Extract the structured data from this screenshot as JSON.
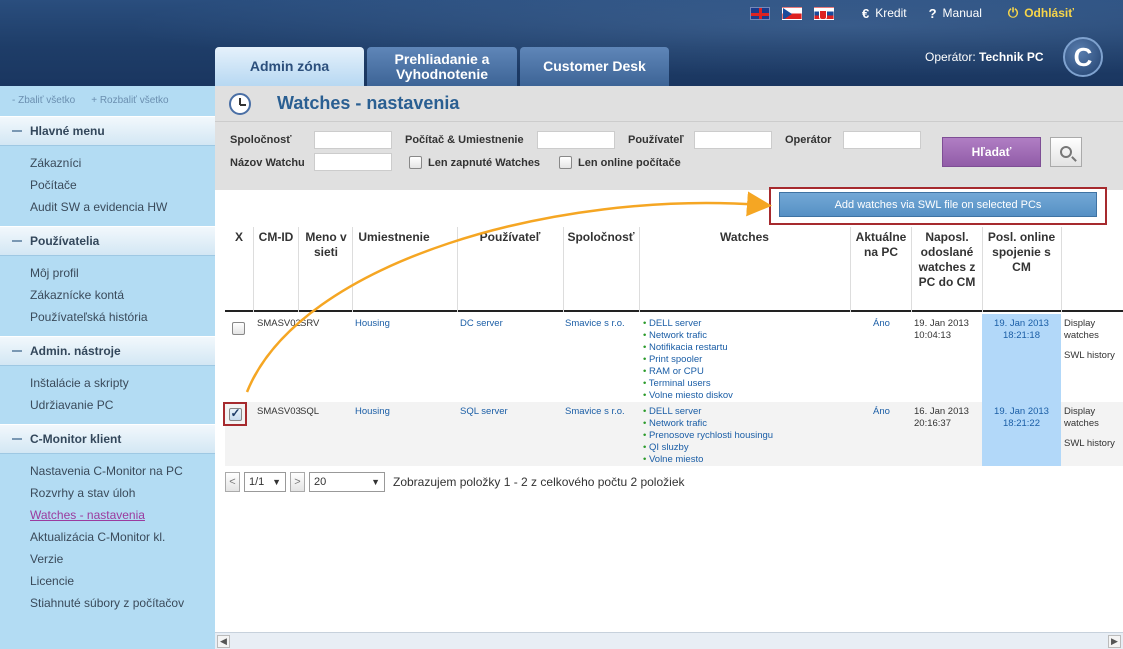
{
  "header": {
    "links": {
      "credit": "Kredit",
      "manual": "Manual",
      "logout": "Odhlásiť"
    },
    "tabs": [
      {
        "label": "Admin zóna"
      },
      {
        "label": "Prehliadanie a Vyhodnotenie"
      },
      {
        "label": "Customer Desk"
      }
    ],
    "operator_label": "Operátor:",
    "operator_name": "Technik PC"
  },
  "sidebar": {
    "collapse_all": "- Zbaliť všetko",
    "expand_all": "+ Rozbaliť všetko",
    "sections": [
      {
        "title": "Hlavné menu",
        "items": [
          "Zákazníci",
          "Počítače",
          "Audit SW a evidencia HW"
        ]
      },
      {
        "title": "Používatelia",
        "items": [
          "Môj profil",
          "Zákaznícke kontá",
          "Používateľská história"
        ]
      },
      {
        "title": "Admin. nástroje",
        "items": [
          "Inštalácie a skripty",
          "Udržiavanie PC"
        ]
      },
      {
        "title": "C-Monitor klient",
        "items": [
          "Nastavenia C-Monitor na PC",
          "Rozvrhy a stav úloh",
          "Watches - nastavenia",
          "Aktualizácia C-Monitor kl.",
          "Verzie",
          "Licencie",
          "Stiahnuté súbory z počítačov"
        ]
      }
    ]
  },
  "page": {
    "title": "Watches - nastavenia"
  },
  "filter": {
    "company_label": "Spoločnosť",
    "computer_label": "Počítač & Umiestnenie",
    "user_label": "Používateľ",
    "operator_label": "Operátor",
    "watch_name_label": "Názov Watchu",
    "only_enabled_label": "Len zapnuté Watches",
    "only_online_label": "Len online počítače",
    "search_label": "Hľadať"
  },
  "add_button_label": "Add watches via SWL file on selected PCs",
  "table": {
    "headers": {
      "x": "X",
      "cmid": "CM-ID",
      "network_name": "Meno v sieti",
      "location": "Umiestnenie",
      "user": "Používateľ",
      "company": "Spoločnosť",
      "watches": "Watches",
      "current_on_pc": "Aktuálne na PC",
      "last_sent": "Naposl. odoslané watches z PC do CM",
      "last_online": "Posl. online spojenie s CM"
    },
    "rows": [
      {
        "cmid": "SMASV02",
        "network_name": "SRV",
        "location": "Housing",
        "user": "DC server",
        "company": "Smavice s r.o.",
        "watches": [
          "DELL server",
          "Network trafic",
          "Notifikacia restartu",
          "Print spooler",
          "RAM or CPU",
          "Terminal users",
          "Volne miesto diskov"
        ],
        "current": "Áno",
        "last_sent_date": "19. Jan 2013",
        "last_sent_time": "10:04:13",
        "last_online_date": "19. Jan 2013",
        "last_online_time": "18:21:18",
        "action_display": "Display watches",
        "action_history": "SWL history"
      },
      {
        "cmid": "SMASV03",
        "network_name": "SQL",
        "location": "Housing",
        "user": "SQL server",
        "company": "Smavice s r.o.",
        "watches": [
          "DELL server",
          "Network trafic",
          "Prenosove rychlosti housingu",
          "QI sluzby",
          "Volne miesto"
        ],
        "current": "Áno",
        "last_sent_date": "16. Jan 2013",
        "last_sent_time": "20:16:37",
        "last_online_date": "19. Jan 2013",
        "last_online_time": "18:21:22",
        "action_display": "Display watches",
        "action_history": "SWL history"
      }
    ]
  },
  "pager": {
    "prev": "<",
    "page": "1/1",
    "next": ">",
    "per_page": "20",
    "summary": "Zobrazujem položky 1 - 2 z celkového počtu 2 položiek"
  },
  "colors": {
    "header_bg": "#1e3d68",
    "sidebar_bg": "#b3dcf3",
    "search_button": "#a26bb8",
    "add_button": "#5b95c9",
    "highlight_cell": "#b2d8f9",
    "annotation_red": "#a62a2e",
    "annotation_arrow": "#f5a623"
  },
  "icons": {
    "credit": "euro-icon",
    "manual": "question-icon",
    "logout": "power-icon",
    "title": "clock-icon",
    "search_extra": "zoom-in-icon"
  }
}
